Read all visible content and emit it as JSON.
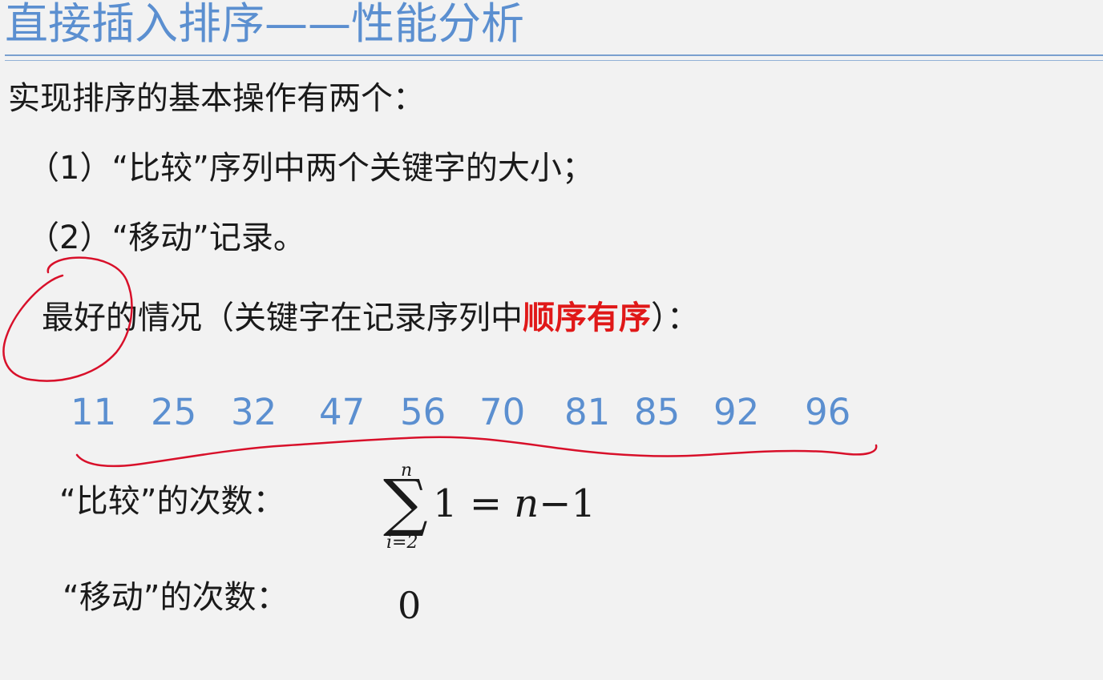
{
  "slide": {
    "title": "直接插入排序——性能分析",
    "intro": "实现排序的基本操作有两个：",
    "item1": "（1）“比较”序列中两个关键字的大小；",
    "item2": "（2）“移动”记录。",
    "best_case": {
      "prefix": "最好的情况（关键字在记录序列中",
      "highlight": "顺序有序",
      "suffix": "）："
    },
    "sequence": [
      "11",
      "25",
      "32",
      "47",
      "56",
      "70",
      "81",
      "85",
      "92",
      "96"
    ],
    "compare": {
      "label": "“比较”的次数：",
      "sum_upper": "n",
      "sum_symbol": "∑",
      "sum_lower": "i=2",
      "sum_body": "1",
      "equals": "=",
      "result_var": "n",
      "result_rest": "−1"
    },
    "move": {
      "label": "“移动”的次数：",
      "value": "0"
    }
  },
  "colors": {
    "title": "#5b8fd0",
    "rule": "#7aa0cf",
    "sequence": "#5b8fd0",
    "highlight": "#e01818",
    "annotation": "#d8102a",
    "background": "#f2f2f2"
  }
}
